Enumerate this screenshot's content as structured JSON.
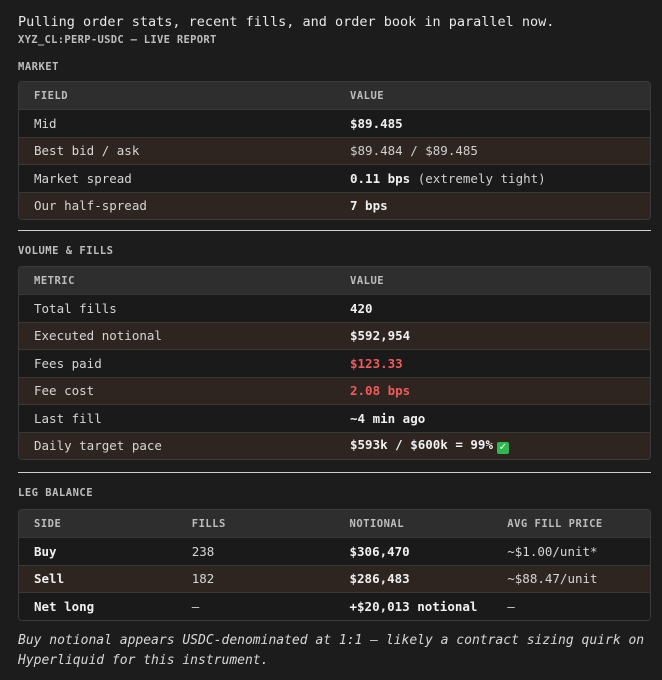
{
  "header": {
    "intro": "Pulling order stats, recent fills, and order book in parallel now.",
    "subtitle": "XYZ_CL:PERP-USDC — LIVE REPORT"
  },
  "market": {
    "title": "MARKET",
    "columns": [
      "FIELD",
      "VALUE"
    ],
    "rows": [
      {
        "field": "Mid",
        "value": "$89.485"
      },
      {
        "field": "Best bid / ask",
        "value": "$89.484 / $89.485"
      },
      {
        "field": "Market spread",
        "value": "0.11 bps",
        "suffix": " (extremely tight)"
      },
      {
        "field": "Our half-spread",
        "value": "7 bps"
      }
    ]
  },
  "volume": {
    "title": "VOLUME & FILLS",
    "columns": [
      "METRIC",
      "VALUE"
    ],
    "rows": [
      {
        "field": "Total fills",
        "value": "420"
      },
      {
        "field": "Executed notional",
        "value": "$592,954"
      },
      {
        "field": "Fees paid",
        "value": "$123.33"
      },
      {
        "field": "Fee cost",
        "value": "2.08 bps"
      },
      {
        "field": "Last fill",
        "value": "~4 min ago"
      },
      {
        "field": "Daily target pace",
        "value": "$593k / $600k = 99%",
        "icon": "check-mark-icon"
      }
    ]
  },
  "legs": {
    "title": "LEG BALANCE",
    "columns": [
      "SIDE",
      "FILLS",
      "NOTIONAL",
      "AVG FILL PRICE"
    ],
    "rows": [
      {
        "side": "Buy",
        "fills": "238",
        "notional": "$306,470",
        "avg": "~$1.00/unit*"
      },
      {
        "side": "Sell",
        "fills": "182",
        "notional": "$286,483",
        "avg": "~$88.47/unit"
      },
      {
        "side": "Net long",
        "fills": "—",
        "notional": "+$20,013 notional",
        "avg": "—"
      }
    ]
  },
  "footnote": "Buy notional appears USDC-denominated at 1:1 — likely a contract sizing quirk on Hyperliquid for this instrument.",
  "colors": {
    "background": "#1c1c1c",
    "warm_row": "#2e2521",
    "negative": "#ef5b5b",
    "check": "#2fb84e"
  }
}
